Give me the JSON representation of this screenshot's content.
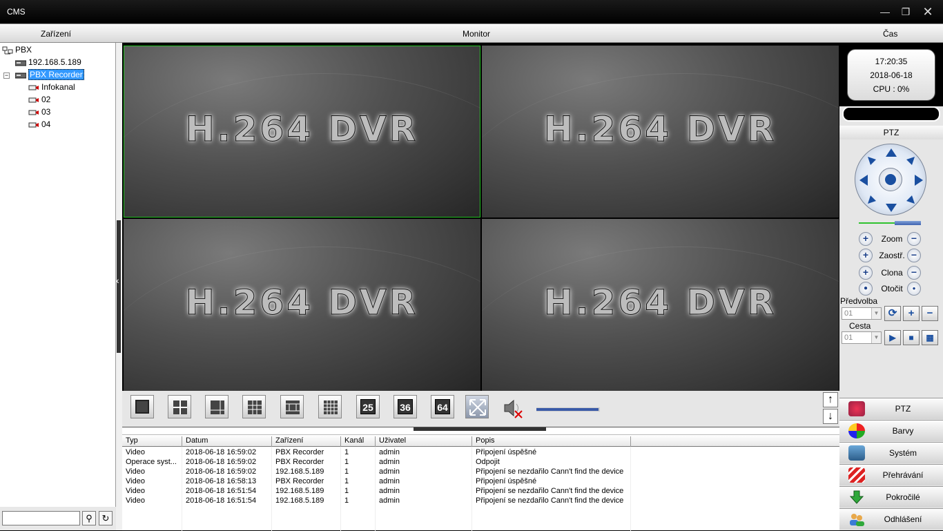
{
  "window": {
    "title": "CMS"
  },
  "menu": {
    "device": "Zařízení",
    "monitor": "Monitor",
    "time": "Čas"
  },
  "tree": {
    "root": "PBX",
    "items": [
      {
        "label": "192.168.5.189"
      },
      {
        "label": "PBX Recorder"
      },
      {
        "label": "Infokanal"
      },
      {
        "label": "02"
      },
      {
        "label": "03"
      },
      {
        "label": "04"
      }
    ]
  },
  "panes": [
    {
      "logo": "H.264 DVR"
    },
    {
      "logo": "H.264 DVR"
    },
    {
      "logo": "H.264 DVR"
    },
    {
      "logo": "H.264 DVR"
    }
  ],
  "status": {
    "time": "17:20:35",
    "date": "2018-06-18",
    "cpu": "CPU : 0%"
  },
  "ptz": {
    "header": "PTZ",
    "zoom": "Zoom",
    "focus": "Zaostř.",
    "iris": "Clona",
    "rotate": "Otočit",
    "preset_label": "Předvolba",
    "preset_value": "01",
    "route_label": "Cesta",
    "route_value": "01"
  },
  "layout_buttons": {
    "b25": "25",
    "b36": "36",
    "b64": "64"
  },
  "volume": {
    "level": 1.0
  },
  "log": {
    "headers": {
      "type": "Typ",
      "date": "Datum",
      "device": "Zařízení",
      "channel": "Kanál",
      "user": "Uživatel",
      "desc": "Popis"
    },
    "rows": [
      {
        "type": "Video",
        "date": "2018-06-18 16:59:02",
        "device": "PBX Recorder",
        "channel": "1",
        "user": "admin",
        "desc": "Připojení úspěšné"
      },
      {
        "type": "Operace syst...",
        "date": "2018-06-18 16:59:02",
        "device": "PBX Recorder",
        "channel": "1",
        "user": "admin",
        "desc": "Odpojit"
      },
      {
        "type": "Video",
        "date": "2018-06-18 16:59:02",
        "device": "192.168.5.189",
        "channel": "1",
        "user": "admin",
        "desc": "Připojení se nezdařilo Cann't find the device"
      },
      {
        "type": "Video",
        "date": "2018-06-18 16:58:13",
        "device": "PBX Recorder",
        "channel": "1",
        "user": "admin",
        "desc": "Připojení úspěšné"
      },
      {
        "type": "Video",
        "date": "2018-06-18 16:51:54",
        "device": "192.168.5.189",
        "channel": "1",
        "user": "admin",
        "desc": "Připojení se nezdařilo Cann't find the device"
      },
      {
        "type": "Video",
        "date": "2018-06-18 16:51:54",
        "device": "192.168.5.189",
        "channel": "1",
        "user": "admin",
        "desc": "Připojení se nezdařilo Cann't find the device"
      }
    ]
  },
  "side_menu": {
    "ptz": "PTZ",
    "colors": "Barvy",
    "system": "Systém",
    "playback": "Přehrávání",
    "advanced": "Pokročilé",
    "logout": "Odhlášení"
  },
  "colors": {
    "active_pane": "#23c223",
    "accent_blue": "#1a4fa0",
    "selection": "#3399ff"
  }
}
